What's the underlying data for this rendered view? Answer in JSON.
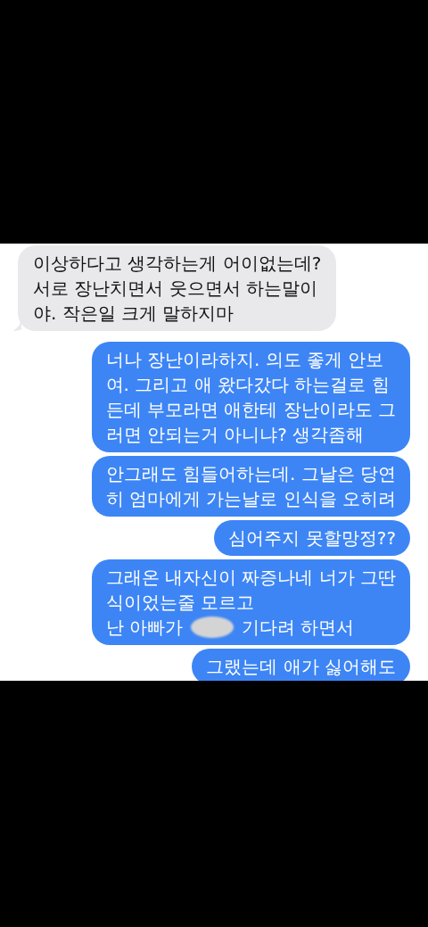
{
  "messages": [
    {
      "kind": "received",
      "lines": [
        [
          {
            "kind": "text",
            "text": "이상하다고 생각하는게 어이없는데?"
          }
        ],
        [
          {
            "kind": "text",
            "text": "서로 장난치면서 웃으면서 하는말이"
          }
        ],
        [
          {
            "kind": "text",
            "text": "야. 작은일 크게 말하지마"
          }
        ]
      ]
    },
    {
      "kind": "sent",
      "lines": [
        [
          {
            "kind": "text",
            "text": "너나 장난이라하지. 의도 좋게 안보"
          }
        ],
        [
          {
            "kind": "text",
            "text": "여. 그리고 애 왔다갔다 하는걸로 힘"
          }
        ],
        [
          {
            "kind": "text",
            "text": "든데 부모라면 애한테 장난이라도 그"
          }
        ],
        [
          {
            "kind": "text",
            "text": "러면 안되는거 아니냐? 생각좀해"
          }
        ]
      ]
    },
    {
      "kind": "sent",
      "lines": [
        [
          {
            "kind": "text",
            "text": "안그래도 힘들어하는데. 그날은 당연"
          }
        ],
        [
          {
            "kind": "text",
            "text": "히 엄마에게 가는날로 인식을 오히려"
          }
        ]
      ]
    },
    {
      "kind": "sent",
      "lines": [
        [
          {
            "kind": "text",
            "text": "심어주지 못할망정??"
          }
        ]
      ]
    },
    {
      "kind": "sent",
      "lines": [
        [
          {
            "kind": "text",
            "text": "그래온 내자신이 짜증나네 너가 그딴"
          }
        ],
        [
          {
            "kind": "text",
            "text": "식이었는줄 모르고"
          }
        ],
        [
          {
            "kind": "text",
            "text": "난 아빠가"
          },
          {
            "kind": "redaction"
          },
          {
            "kind": "text",
            "text": "기다려 하면서"
          }
        ]
      ]
    },
    {
      "kind": "sent",
      "lines": [
        [
          {
            "kind": "text",
            "text": "그랬는데 애가 싫어해도"
          }
        ]
      ]
    }
  ]
}
